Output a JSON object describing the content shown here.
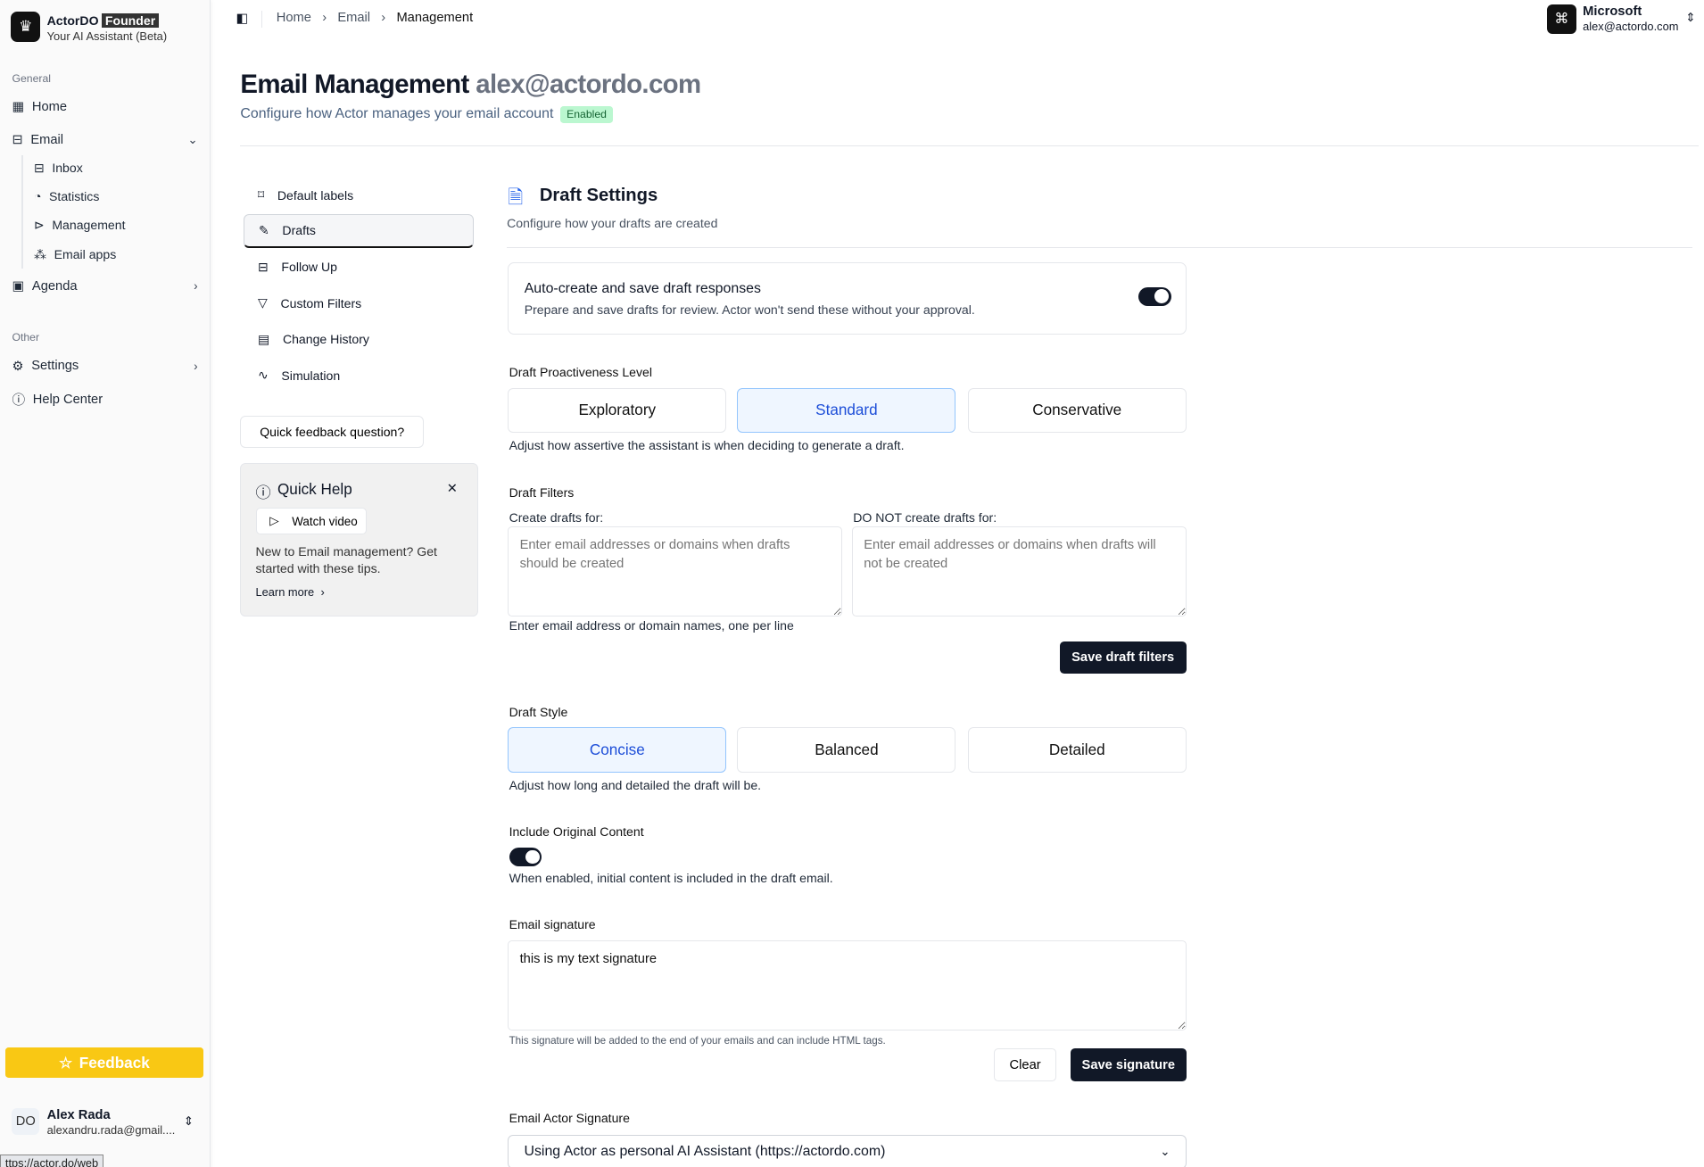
{
  "app": {
    "name": "ActorDO",
    "badge": "Founder",
    "tagline": "Your AI Assistant (Beta)"
  },
  "sidebar": {
    "general_label": "General",
    "other_label": "Other",
    "items": [
      {
        "label": "Home"
      },
      {
        "label": "Email"
      },
      {
        "label": "Agenda"
      },
      {
        "label": "Settings"
      },
      {
        "label": "Help Center"
      }
    ],
    "email_sub": [
      {
        "label": "Inbox"
      },
      {
        "label": "Statistics"
      },
      {
        "label": "Management"
      },
      {
        "label": "Email apps"
      }
    ],
    "feedback": "Feedback",
    "user": {
      "initials": "DO",
      "name": "Alex Rada",
      "email": "alexandru.rada@gmail...."
    }
  },
  "status_bar": "ttps://actor.do/web",
  "breadcrumb": [
    "Home",
    "Email",
    "Management"
  ],
  "account": {
    "provider": "Microsoft",
    "email": "alex@actordo.com"
  },
  "header": {
    "title": "Email Management",
    "email": "alex@actordo.com",
    "subtitle": "Configure how Actor manages your email account",
    "status": "Enabled"
  },
  "settings_nav": [
    {
      "label": "Default labels"
    },
    {
      "label": "Drafts"
    },
    {
      "label": "Follow Up"
    },
    {
      "label": "Custom Filters"
    },
    {
      "label": "Change History"
    },
    {
      "label": "Simulation"
    }
  ],
  "quick_feedback": "Quick feedback question?",
  "quick_help": {
    "title": "Quick Help",
    "watch": "Watch video",
    "text": "New to Email management? Get started with these tips.",
    "learn": "Learn more"
  },
  "draft": {
    "title": "Draft Settings",
    "subtitle": "Configure how your drafts are created",
    "auto": {
      "title": "Auto-create and save draft responses",
      "desc": "Prepare and save drafts for review. Actor won't send these without your approval.",
      "enabled": true
    },
    "proactive": {
      "label": "Draft Proactiveness Level",
      "options": [
        "Exploratory",
        "Standard",
        "Conservative"
      ],
      "selected": "Standard",
      "help": "Adjust how assertive the assistant is when deciding to generate a draft."
    },
    "filters": {
      "label": "Draft Filters",
      "create_label": "Create drafts for:",
      "create_ph": "Enter email addresses or domains when drafts should be created",
      "not_label": "DO NOT create drafts for:",
      "not_ph": "Enter email addresses or domains when drafts will not be created",
      "help": "Enter email address or domain names, one per line",
      "save": "Save draft filters"
    },
    "style": {
      "label": "Draft Style",
      "options": [
        "Concise",
        "Balanced",
        "Detailed"
      ],
      "selected": "Concise",
      "help": "Adjust how long and detailed the draft will be."
    },
    "original": {
      "label": "Include Original Content",
      "help": "When enabled, initial content is included in the draft email.",
      "enabled": true
    },
    "signature": {
      "label": "Email signature",
      "value": "this is my text signature",
      "help": "This signature will be added to the end of your emails and can include HTML tags.",
      "clear": "Clear",
      "save": "Save signature"
    },
    "actor_sig": {
      "label": "Email Actor Signature",
      "selected": "Using Actor as personal AI Assistant (https://actordo.com)"
    }
  }
}
